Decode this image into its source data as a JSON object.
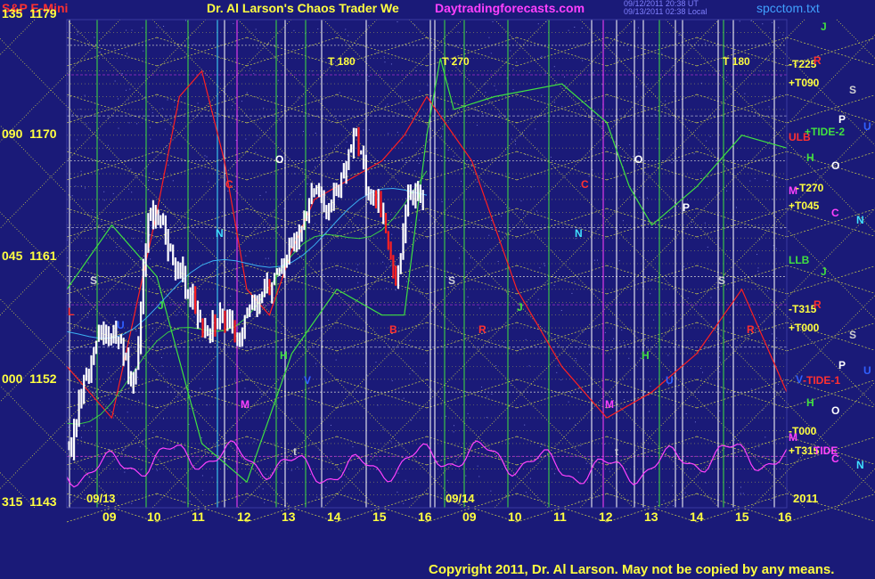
{
  "header": {
    "instrument": "S&P E-Mini",
    "title": "Dr. Al Larson's Chaos Trader We",
    "site": "Daytradingforecasts.com",
    "stamp_line1": "09/12/2011 20:38 UT",
    "stamp_line2": "09/13/2011 02:38 Local",
    "filename": "spcctom.txt"
  },
  "y_labels": [
    {
      "deg": "135",
      "price": "1179"
    },
    {
      "deg": "090",
      "price": "1170"
    },
    {
      "deg": "045",
      "price": "1161"
    },
    {
      "deg": "000",
      "price": "1152"
    },
    {
      "deg": "315",
      "price": "1143"
    }
  ],
  "x_labels": [
    "09",
    "10",
    "11",
    "12",
    "13",
    "14",
    "15",
    "16",
    "09",
    "10",
    "11",
    "12",
    "13",
    "14",
    "15",
    "16"
  ],
  "date_labels": [
    "09/13",
    "09/14"
  ],
  "year_label": "2011",
  "top_markers": [
    "T 180",
    "T 270",
    "T 180"
  ],
  "chart_letters": [
    "O",
    "C",
    "N",
    "S",
    "U",
    "H",
    "V",
    "M",
    "L",
    "t",
    "B",
    "J",
    "R",
    "C",
    "O",
    "N",
    "S",
    "J",
    "R",
    "H",
    "M",
    "t",
    "U",
    "P",
    "S"
  ],
  "right_labels": [
    {
      "text": "J",
      "color": "#40e040"
    },
    {
      "text": "-T225",
      "color": "#ffff40"
    },
    {
      "text": "R",
      "color": "#ff3030"
    },
    {
      "text": "+T090",
      "color": "#ffff40"
    },
    {
      "text": "S",
      "color": "#d0d0d0"
    },
    {
      "text": "P",
      "color": "#ffffff"
    },
    {
      "text": "U",
      "color": "#3060ff"
    },
    {
      "text": "ULB",
      "color": "#ff3030"
    },
    {
      "text": "+TIDE-2",
      "color": "#40e040"
    },
    {
      "text": "H",
      "color": "#40e040"
    },
    {
      "text": "O",
      "color": "#ffffff"
    },
    {
      "text": "M",
      "color": "#ff40ff"
    },
    {
      "text": "-T270",
      "color": "#ffff40"
    },
    {
      "text": "+T045",
      "color": "#ffff40"
    },
    {
      "text": "C",
      "color": "#ff40ff"
    },
    {
      "text": "N",
      "color": "#40e0ff"
    },
    {
      "text": "LLB",
      "color": "#40e040"
    },
    {
      "text": "J",
      "color": "#40e040"
    },
    {
      "text": "-T315",
      "color": "#ffff40"
    },
    {
      "text": "R",
      "color": "#ff3030"
    },
    {
      "text": "+T000",
      "color": "#ffff40"
    },
    {
      "text": "S",
      "color": "#d0d0d0"
    },
    {
      "text": "P",
      "color": "#ffffff"
    },
    {
      "text": "U",
      "color": "#3060ff"
    },
    {
      "text": "V",
      "color": "#3060ff"
    },
    {
      "text": "-TIDE-1",
      "color": "#ff3030"
    },
    {
      "text": "H",
      "color": "#40e040"
    },
    {
      "text": "O",
      "color": "#ffffff"
    },
    {
      "text": "-T000",
      "color": "#ffff40"
    },
    {
      "text": "M",
      "color": "#ff40ff"
    },
    {
      "text": "+T315",
      "color": "#ffff40"
    },
    {
      "text": "TIDE",
      "color": "#ff40ff"
    },
    {
      "text": "C",
      "color": "#ff40ff"
    },
    {
      "text": "N",
      "color": "#40e0ff"
    }
  ],
  "copyright": "Copyright 2011, Dr. Al Larson. May not be copied by any means.",
  "colors": {
    "background": "#1a1a78",
    "price_bars": "#ffffff",
    "down_bars": "#ff2020",
    "grid_lines": "#ffff40",
    "vertical_green": "#40e040",
    "vertical_white": "#ffffff",
    "vertical_magenta": "#ff40ff",
    "vertical_cyan": "#40e0ff",
    "red_flux": "#ff2020",
    "green_flux": "#40e040",
    "magenta_tide": "#ff40ff",
    "title_yellow": "#ffff40",
    "site_magenta": "#ff40ff",
    "stamp_blue": "#8080ff"
  },
  "chart_data": {
    "type": "line",
    "y_axis_price_ticks": [
      1179,
      1170,
      1161,
      1152,
      1143
    ],
    "y_axis_degree_ticks": [
      "135",
      "090",
      "045",
      "000",
      "315"
    ],
    "ylim": [
      1143,
      1181
    ],
    "x_sessions": [
      {
        "date": "09/13",
        "hours": [
          "09",
          "10",
          "11",
          "12",
          "13",
          "14",
          "15",
          "16"
        ]
      },
      {
        "date": "09/14",
        "hours": [
          "09",
          "10",
          "11",
          "12",
          "13",
          "14",
          "15",
          "16"
        ]
      }
    ],
    "series": [
      {
        "role": "price",
        "x_hours": [
          8.1,
          8.4,
          8.8,
          9.2,
          9.5,
          9.8,
          10.1,
          10.4,
          10.8,
          11.1,
          11.4,
          11.8,
          12.1,
          12.5,
          12.9,
          13.2,
          13.5,
          13.8,
          14.1,
          14.4,
          14.7,
          15.0,
          15.3,
          15.6,
          15.9
        ],
        "y": [
          1148,
          1153,
          1157,
          1156,
          1152,
          1166,
          1165,
          1162,
          1159,
          1157,
          1158,
          1156,
          1159,
          1160,
          1163,
          1164,
          1168,
          1166,
          1169,
          1172,
          1168,
          1166,
          1160,
          1168,
          1167
        ]
      },
      {
        "role": "red flux",
        "x_hours": [
          8.0,
          9.0,
          10.0,
          10.5,
          11.0,
          11.5,
          12.0,
          12.5,
          13.0,
          13.5,
          14.0,
          14.5,
          15.0,
          15.5,
          16.0,
          17.0,
          18.0,
          19.0,
          20.0,
          21.0,
          22.0,
          23.0,
          24.0
        ],
        "y": [
          1154,
          1150,
          1166,
          1175,
          1177,
          1170,
          1160,
          1158,
          1163,
          1167,
          1168,
          1169,
          1170,
          1172,
          1175,
          1170,
          1160,
          1154,
          1150,
          1152,
          1155,
          1160,
          1152
        ]
      },
      {
        "role": "green flux",
        "x_hours": [
          8.0,
          9.0,
          10.0,
          11.0,
          12.0,
          13.0,
          14.0,
          15.0,
          15.5,
          16.0,
          16.3,
          16.6,
          17.5,
          19.0,
          20.0,
          20.5,
          21.0,
          22.0,
          23.0,
          24.0
        ],
        "y": [
          1160,
          1165,
          1161,
          1148,
          1145,
          1155,
          1160,
          1158,
          1158,
          1172,
          1178,
          1174,
          1175,
          1176,
          1173,
          1168,
          1165,
          1168,
          1172,
          1171
        ]
      }
    ]
  }
}
